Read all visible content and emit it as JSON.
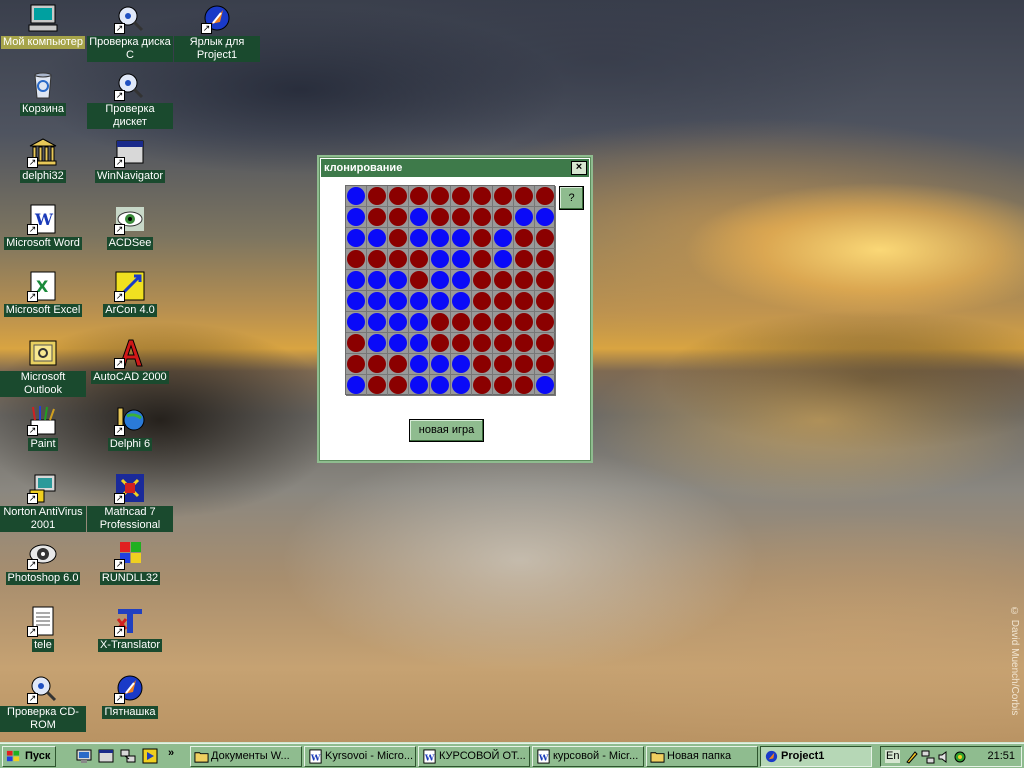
{
  "desktop": {
    "copyright": "© David Muench/Corbis",
    "icons": [
      {
        "label": "Мой компьютер",
        "icon": "my-computer-icon",
        "shortcut": false,
        "selected": true
      },
      {
        "label": "Корзина",
        "icon": "recycle-bin-icon",
        "shortcut": false,
        "selected": false
      },
      {
        "label": "delphi32",
        "icon": "delphi-icon",
        "shortcut": true,
        "selected": false
      },
      {
        "label": "Microsoft Word",
        "icon": "word-icon",
        "shortcut": true,
        "selected": false
      },
      {
        "label": "Microsoft Excel",
        "icon": "excel-icon",
        "shortcut": true,
        "selected": false
      },
      {
        "label": "Microsoft Outlook",
        "icon": "outlook-icon",
        "shortcut": false,
        "selected": false
      },
      {
        "label": "Paint",
        "icon": "paint-icon",
        "shortcut": true,
        "selected": false
      },
      {
        "label": "Norton AntiVirus 2001",
        "icon": "norton-icon",
        "shortcut": true,
        "selected": false
      },
      {
        "label": "Photoshop 6.0",
        "icon": "photoshop-icon",
        "shortcut": true,
        "selected": false
      },
      {
        "label": "tele",
        "icon": "document-icon",
        "shortcut": true,
        "selected": false
      },
      {
        "label": "Проверка CD-ROM",
        "icon": "disk-check-icon",
        "shortcut": true,
        "selected": false
      },
      {
        "label": "Проверка диска C",
        "icon": "disk-check-icon",
        "shortcut": true,
        "selected": false
      },
      {
        "label": "Проверка дискет",
        "icon": "disk-check-icon",
        "shortcut": true,
        "selected": false
      },
      {
        "label": "WinNavigator",
        "icon": "window-icon",
        "shortcut": true,
        "selected": false
      },
      {
        "label": "ACDSee",
        "icon": "acdsee-icon",
        "shortcut": true,
        "selected": false
      },
      {
        "label": "ArCon 4.0",
        "icon": "arcon-icon",
        "shortcut": true,
        "selected": false
      },
      {
        "label": "AutoCAD 2000",
        "icon": "autocad-icon",
        "shortcut": true,
        "selected": false
      },
      {
        "label": "Delphi 6",
        "icon": "delphi6-icon",
        "shortcut": true,
        "selected": false
      },
      {
        "label": "Mathcad 7 Professional",
        "icon": "mathcad-icon",
        "shortcut": true,
        "selected": false
      },
      {
        "label": "RUNDLL32",
        "icon": "rundll-icon",
        "shortcut": true,
        "selected": false
      },
      {
        "label": "X-Translator",
        "icon": "translator-icon",
        "shortcut": true,
        "selected": false
      },
      {
        "label": "Пятнашка",
        "icon": "project-icon",
        "shortcut": true,
        "selected": false
      },
      {
        "label": "Ярлык для Project1",
        "icon": "project-icon",
        "shortcut": true,
        "selected": false
      }
    ]
  },
  "dialog": {
    "title": "клонирование",
    "close_label": "×",
    "help_label": "?",
    "new_game_label": "новая игра",
    "colors": {
      "blue": "#0a0af8",
      "red": "#8b0000",
      "frame": "#3e7a4a"
    },
    "grid": [
      "BRRRRRRRRR",
      "BRRBRRRRBB",
      "BBRBBBRBRR",
      "RRRRBBRBRR",
      "BBBRBBRRRR",
      "BBBBBBRRRR",
      "BBBBRRRRRR",
      "RBBBRRRRRR",
      "RRRBBBRRRR",
      "BRRBBBRRRB"
    ]
  },
  "taskbar": {
    "start_label": "Пуск",
    "quick_launch": [
      "show-desktop-icon",
      "window-icon",
      "network-icon",
      "media-icon"
    ],
    "overflow": "»",
    "buttons": [
      {
        "label": "Документы W...",
        "icon": "folder-icon",
        "active": false
      },
      {
        "label": "Kyrsovoi - Micro...",
        "icon": "word-doc-icon",
        "active": false
      },
      {
        "label": "КУРСОВОЙ ОТ...",
        "icon": "word-doc-icon",
        "active": false
      },
      {
        "label": "курсовой - Micr...",
        "icon": "word-doc-icon",
        "active": false
      },
      {
        "label": "Новая папка",
        "icon": "folder-icon",
        "active": false
      },
      {
        "label": "Project1",
        "icon": "project-icon",
        "active": true
      }
    ],
    "tray": {
      "lang": "En",
      "time": "21:51",
      "icons": [
        "pen-icon",
        "network-tray-icon",
        "volume-icon",
        "antivirus-tray-icon"
      ]
    }
  }
}
